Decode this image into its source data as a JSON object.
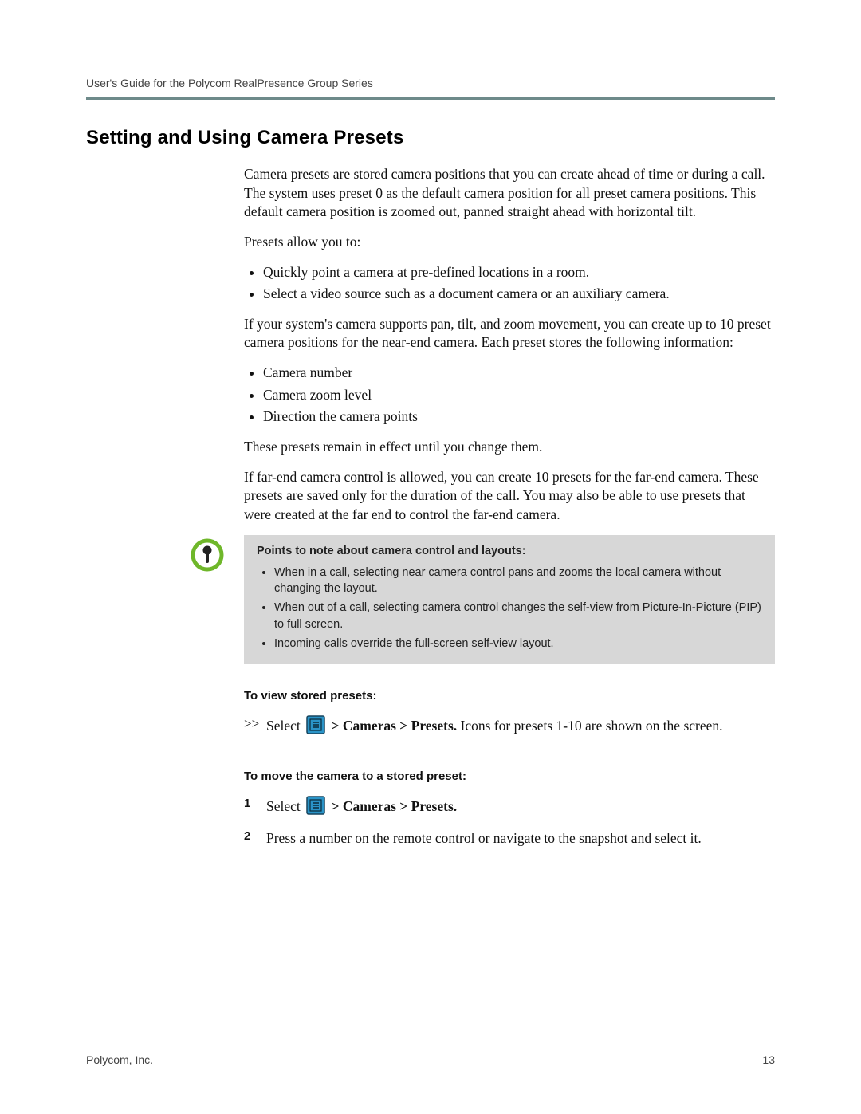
{
  "header": {
    "running": "User's Guide for the Polycom RealPresence Group Series"
  },
  "section": {
    "title": "Setting and Using Camera Presets"
  },
  "intro": {
    "p1": "Camera presets are stored camera positions that you can create ahead of time or during a call. The system uses preset 0 as the default camera position for all preset camera positions. This default camera position is zoomed out, panned straight ahead with horizontal tilt.",
    "p2": "Presets allow you to:",
    "bullets1": [
      "Quickly point a camera at pre-defined locations in a room.",
      "Select a video source such as a document camera or an auxiliary camera."
    ],
    "p3": "If your system's camera supports pan, tilt, and zoom movement, you can create up to 10 preset camera positions for the near-end camera. Each preset stores the following information:",
    "bullets2": [
      "Camera number",
      "Camera zoom level",
      "Direction the camera points"
    ],
    "p4": "These presets remain in effect until you change them.",
    "p5": "If far-end camera control is allowed, you can create 10 presets for the far-end camera. These presets are saved only for the duration of the call. You may also be able to use presets that were created at the far end to control the far-end camera."
  },
  "note": {
    "title": "Points to note about camera control and layouts:",
    "items": [
      "When in a call, selecting near camera control pans and zooms the local camera without changing the layout.",
      "When out of a call, selecting camera control changes the self-view from Picture-In-Picture (PIP) to full screen.",
      "Incoming calls override the full-screen self-view layout."
    ]
  },
  "task_view": {
    "heading": "To view stored presets:",
    "arrow": ">>",
    "select_word": "Select ",
    "breadcrumb": " > Cameras > Presets.",
    "rest": " Icons for presets 1-10 are shown on the screen."
  },
  "task_move": {
    "heading": "To move the camera to a stored preset:",
    "step1_num": "1",
    "step1_select": "Select ",
    "step1_crumb": " > Cameras > Presets.",
    "step2_num": "2",
    "step2_text": "Press a number on the remote control or navigate to the snapshot and select it."
  },
  "footer": {
    "left": "Polycom, Inc.",
    "right": "13"
  }
}
